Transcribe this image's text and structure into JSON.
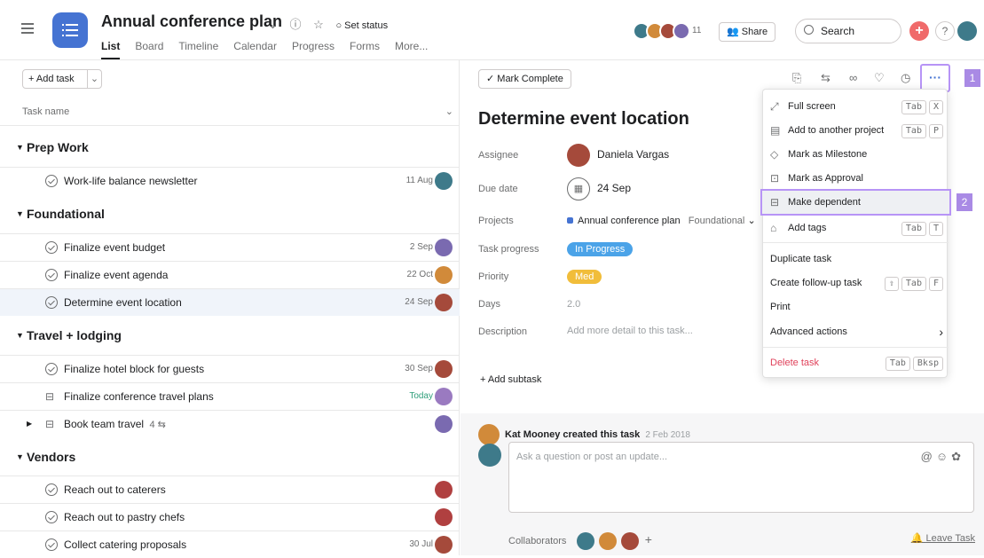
{
  "project": {
    "title": "Annual conference plan",
    "set_status": "Set status",
    "tabs": [
      "List",
      "Board",
      "Timeline",
      "Calendar",
      "Progress",
      "Forms",
      "More..."
    ],
    "member_count": "11",
    "share_label": "Share",
    "search_placeholder": "Search",
    "help_label": "?"
  },
  "list": {
    "add_task_label": "+ Add task",
    "column_header": "Task name",
    "sections": [
      {
        "name": "Prep Work",
        "tasks": [
          {
            "name": "Work-life balance newsletter",
            "date": "11 Aug"
          }
        ]
      },
      {
        "name": "Foundational",
        "tasks": [
          {
            "name": "Finalize event budget",
            "date": "2 Sep"
          },
          {
            "name": "Finalize event agenda",
            "date": "22 Oct"
          },
          {
            "name": "Determine event location",
            "date": "24 Sep"
          }
        ]
      },
      {
        "name": "Travel + lodging",
        "tasks": [
          {
            "name": "Finalize hotel block for guests",
            "date": "30 Sep"
          },
          {
            "name": "Finalize conference travel plans",
            "date": "Today"
          },
          {
            "name": "Book team travel",
            "subtask_count": "4",
            "date": ""
          }
        ]
      },
      {
        "name": "Vendors",
        "tasks": [
          {
            "name": "Reach out to caterers",
            "date": ""
          },
          {
            "name": "Reach out to pastry chefs",
            "date": ""
          },
          {
            "name": "Collect catering proposals",
            "date": "30 Jul"
          }
        ]
      }
    ]
  },
  "detail": {
    "mark_complete": "Mark Complete",
    "title": "Determine event location",
    "labels": {
      "assignee": "Assignee",
      "due_date": "Due date",
      "projects": "Projects",
      "task_progress": "Task progress",
      "priority": "Priority",
      "days": "Days",
      "description": "Description"
    },
    "assignee": "Daniela Vargas",
    "due_date": "24 Sep",
    "project_name": "Annual conference plan",
    "project_section": "Foundational",
    "task_progress": "In Progress",
    "priority": "Med",
    "days": "2.0",
    "description_placeholder": "Add more detail to this task...",
    "add_subtask": "+ Add subtask",
    "activity": {
      "author": "Kat Mooney created this task",
      "time": "2 Feb 2018"
    },
    "comment_placeholder": "Ask a question or post an update...",
    "collaborators_label": "Collaborators",
    "leave_task": "Leave Task"
  },
  "menu": {
    "items": [
      {
        "label": "Full screen",
        "keys": [
          "Tab",
          "X"
        ]
      },
      {
        "label": "Add to another project",
        "keys": [
          "Tab",
          "P"
        ]
      },
      {
        "label": "Mark as Milestone",
        "keys": []
      },
      {
        "label": "Mark as Approval",
        "keys": []
      },
      {
        "label": "Make dependent",
        "keys": []
      },
      {
        "label": "Add tags",
        "keys": [
          "Tab",
          "T"
        ]
      },
      {
        "label": "Duplicate task",
        "keys": []
      },
      {
        "label": "Create follow-up task",
        "keys": [
          "⇧",
          "Tab",
          "F"
        ]
      },
      {
        "label": "Print",
        "keys": []
      },
      {
        "label": "Advanced actions",
        "keys": []
      },
      {
        "label": "Delete task",
        "keys": [
          "Tab",
          "Bksp"
        ]
      }
    ]
  },
  "callouts": {
    "one": "1",
    "two": "2"
  },
  "colors": {
    "accent": "#4573d2",
    "brand_red": "#f06a6a",
    "highlight": "#b794f6",
    "progress_pill": "#4ba3e8",
    "priority_pill": "#f1bd3a"
  }
}
